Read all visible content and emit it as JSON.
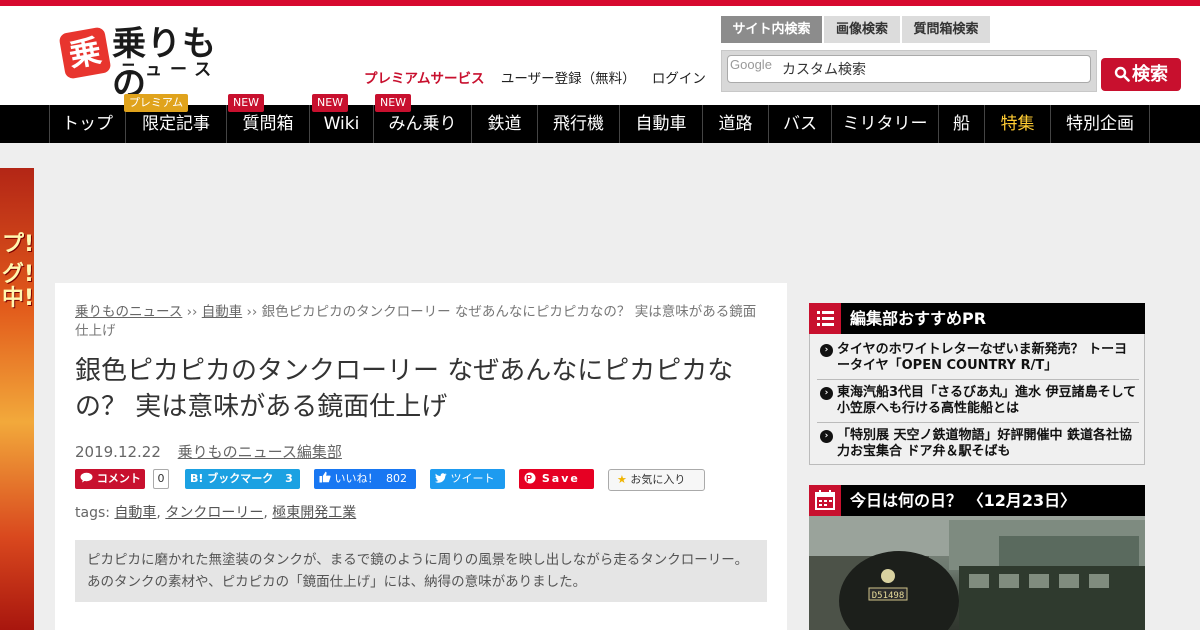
{
  "header": {
    "logo_main": "乗りもの",
    "logo_sub": "ニュース",
    "logo_badge": "乗",
    "util_links": [
      "プレミアムサービス",
      "ユーザー登録（無料）",
      "ログイン"
    ]
  },
  "search": {
    "tabs": [
      "サイト内検索",
      "画像検索",
      "質問箱検索"
    ],
    "google_label": "Google",
    "placeholder": "カスタム検索",
    "button_label": "検索"
  },
  "nav": {
    "items": [
      "トップ",
      "限定記事",
      "質問箱",
      "Wiki",
      "みん乗り",
      "鉄道",
      "飛行機",
      "自動車",
      "道路",
      "バス",
      "ミリタリー",
      "船",
      "特集",
      "特別企画"
    ],
    "badges": {
      "premium": "プレミアム",
      "new": "NEW"
    }
  },
  "ad": {
    "text_1": "プ!!",
    "text_2": "グ!",
    "text_3": "中!!"
  },
  "breadcrumb": {
    "home": "乗りものニュース",
    "sep": "››",
    "category": "自動車",
    "current": "銀色ピカピカのタンクローリー なぜあんなにピカピカなの？ 実は意味がある鏡面仕上げ"
  },
  "article": {
    "title": "銀色ピカピカのタンクローリー なぜあんなにピカピカなの？ 実は意味がある鏡面仕上げ",
    "date": "2019.12.22",
    "author": "乗りものニュース編集部",
    "tags_label": "tags:",
    "tags": [
      "自動車",
      "タンクローリー",
      "極東開発工業"
    ],
    "lede": "ピカピカに磨かれた無塗装のタンクが、まるで鏡のように周りの風景を映し出しながら走るタンクローリー。あのタンクの素材や、ピカピカの「鏡面仕上げ」には、納得の意味がありました。"
  },
  "share": {
    "comment_label": "コメント",
    "comment_count": "0",
    "hatena_label": "B! ブックマーク",
    "hatena_count": "3",
    "like_label": "いいね！",
    "like_count": "802",
    "tweet_label": "ツイート",
    "pin_label": "Save",
    "fav_label": "お気に入り"
  },
  "sidebar": {
    "pr_title": "編集部おすすめPR",
    "pr_items": [
      "タイヤのホワイトレターなぜいま新発売？ トーヨータイヤ「OPEN COUNTRY R/T」",
      "東海汽船3代目「さるびあ丸」進水 伊豆諸島そして小笠原へも行ける高性能船とは",
      "「特別展 天空ノ鉄道物語」好評開催中 鉄道各社協力お宝集合 ドア弁＆駅そばも"
    ],
    "today_title": "今日は何の日？ 〈12月23日〉",
    "photo_plate": "D51498"
  },
  "colors": {
    "brand_red": "#c8102e",
    "nav_black": "#000000",
    "tokushu_yellow": "#ffcc33"
  }
}
